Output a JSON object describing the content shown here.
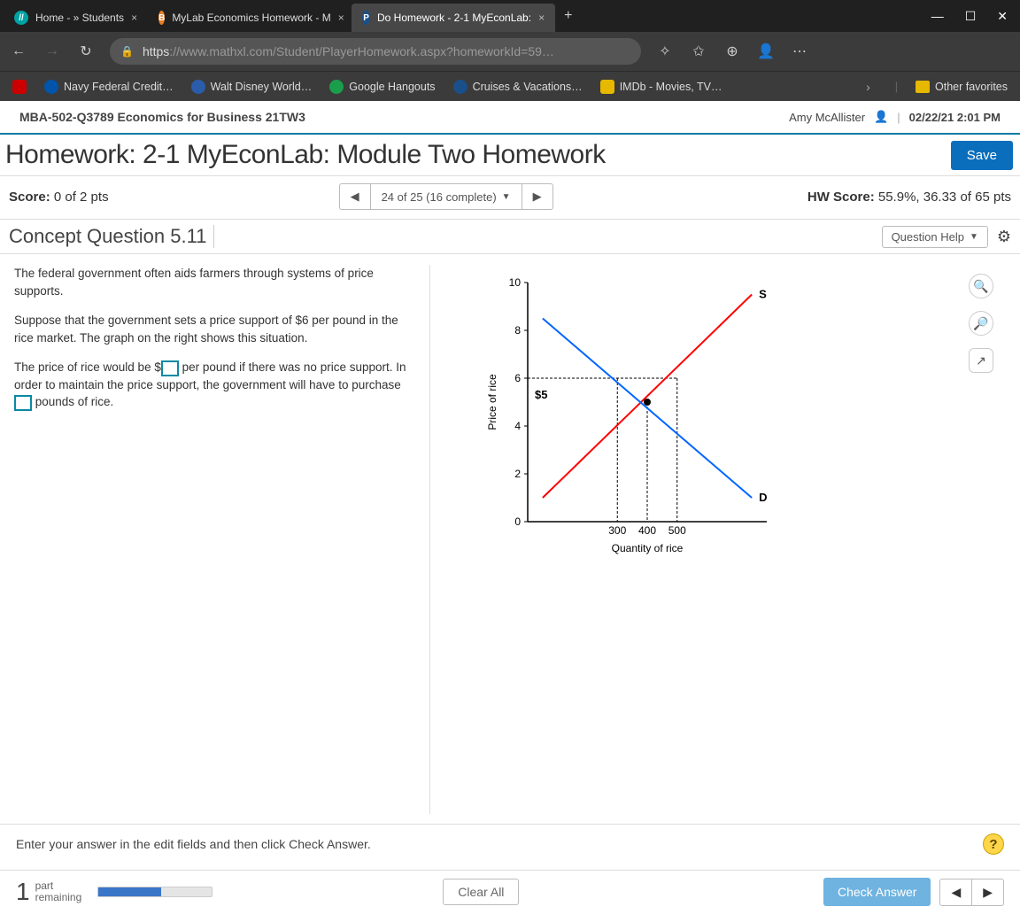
{
  "browser": {
    "tabs": [
      {
        "label": "Home - » Students",
        "favbg": "#00a3a3",
        "favtxt": "//"
      },
      {
        "label": "MyLab Economics Homework - M",
        "favbg": "#e67e22",
        "favtxt": "B"
      },
      {
        "label": "Do Homework - 2-1 MyEconLab:",
        "favbg": "#1a4f8a",
        "favtxt": "P",
        "active": true
      }
    ],
    "url_proto": "https",
    "url_host": "://www.mathxl.com",
    "url_path": "/Student/PlayerHomework.aspx?homeworkId=59…",
    "bookmarks": [
      "Navy Federal Credit…",
      "Walt Disney World…",
      "Google Hangouts",
      "Cruises & Vacations…",
      "IMDb - Movies, TV…"
    ],
    "other_fav": "Other favorites"
  },
  "course": {
    "name": "MBA-502-Q3789 Economics for Business 21TW3",
    "user": "Amy McAllister",
    "datetime": "02/22/21 2:01 PM"
  },
  "hw": {
    "title": "Homework: 2-1 MyEconLab: Module Two Homework",
    "save": "Save"
  },
  "scorebar": {
    "score_label": "Score:",
    "score_val": "0 of 2 pts",
    "pager": "24 of 25 (16 complete)",
    "hw_score_label": "HW Score:",
    "hw_score_val": "55.9%, 36.33 of 65 pts"
  },
  "concept": {
    "title": "Concept Question 5.11",
    "help": "Question Help"
  },
  "question": {
    "p1": "The federal government often aids farmers through systems of price supports.",
    "p2": "Suppose that the government sets a price support of $6 per pound in the rice market. The graph on the right shows this situation.",
    "p3a": "The price of rice would be $",
    "p3b": " per pound if there was  no price support. In order to maintain the price support, the government will have to purchase ",
    "p3c": " pounds of rice."
  },
  "chart_data": {
    "type": "line",
    "title": "",
    "xlabel": "Quantity of rice",
    "ylabel": "Price of rice",
    "xlim": [
      0,
      800
    ],
    "ylim": [
      0,
      10
    ],
    "yticks": [
      0,
      2,
      4,
      6,
      8,
      10
    ],
    "xticks_labeled": [
      300,
      400,
      500
    ],
    "series": [
      {
        "name": "S",
        "points": [
          [
            50,
            1
          ],
          [
            750,
            9.5
          ]
        ],
        "color": "#ff0000"
      },
      {
        "name": "D",
        "points": [
          [
            50,
            8.5
          ],
          [
            750,
            1
          ]
        ],
        "color": "#0066ff"
      }
    ],
    "equilibrium": {
      "q": 400,
      "p": 5,
      "label": "$5"
    },
    "price_support": {
      "p": 6,
      "q_demand": 300,
      "q_supply": 500
    }
  },
  "instruction": "Enter your answer in the edit fields and then click Check Answer.",
  "footer": {
    "part_num": "1",
    "part_txt_a": "part",
    "part_txt_b": "remaining",
    "clear": "Clear All",
    "check": "Check Answer"
  }
}
